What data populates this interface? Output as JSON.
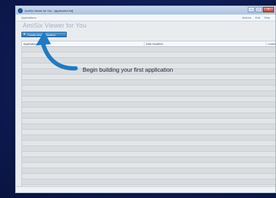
{
  "window": {
    "title": "AmiSix Viewer for You - [application list]",
    "menu_left": "Applications",
    "menu_right": [
      "Actions",
      "Edit",
      "Help"
    ],
    "controls": [
      "–",
      "□",
      "×"
    ]
  },
  "heading": "AmiSix Viewer for You",
  "new_app_button": {
    "label": "Create new application",
    "icon": "plus-icon"
  },
  "table": {
    "columns": [
      "Application name",
      "Date Modified",
      "Locked"
    ],
    "row_count": 26
  },
  "callout": {
    "text": "Begin building your first application",
    "arrow_color": "#1e7bc4"
  },
  "colors": {
    "desktop": "#0e1c55",
    "accent": "#2e78b8",
    "heading": "#9fb0c6"
  }
}
